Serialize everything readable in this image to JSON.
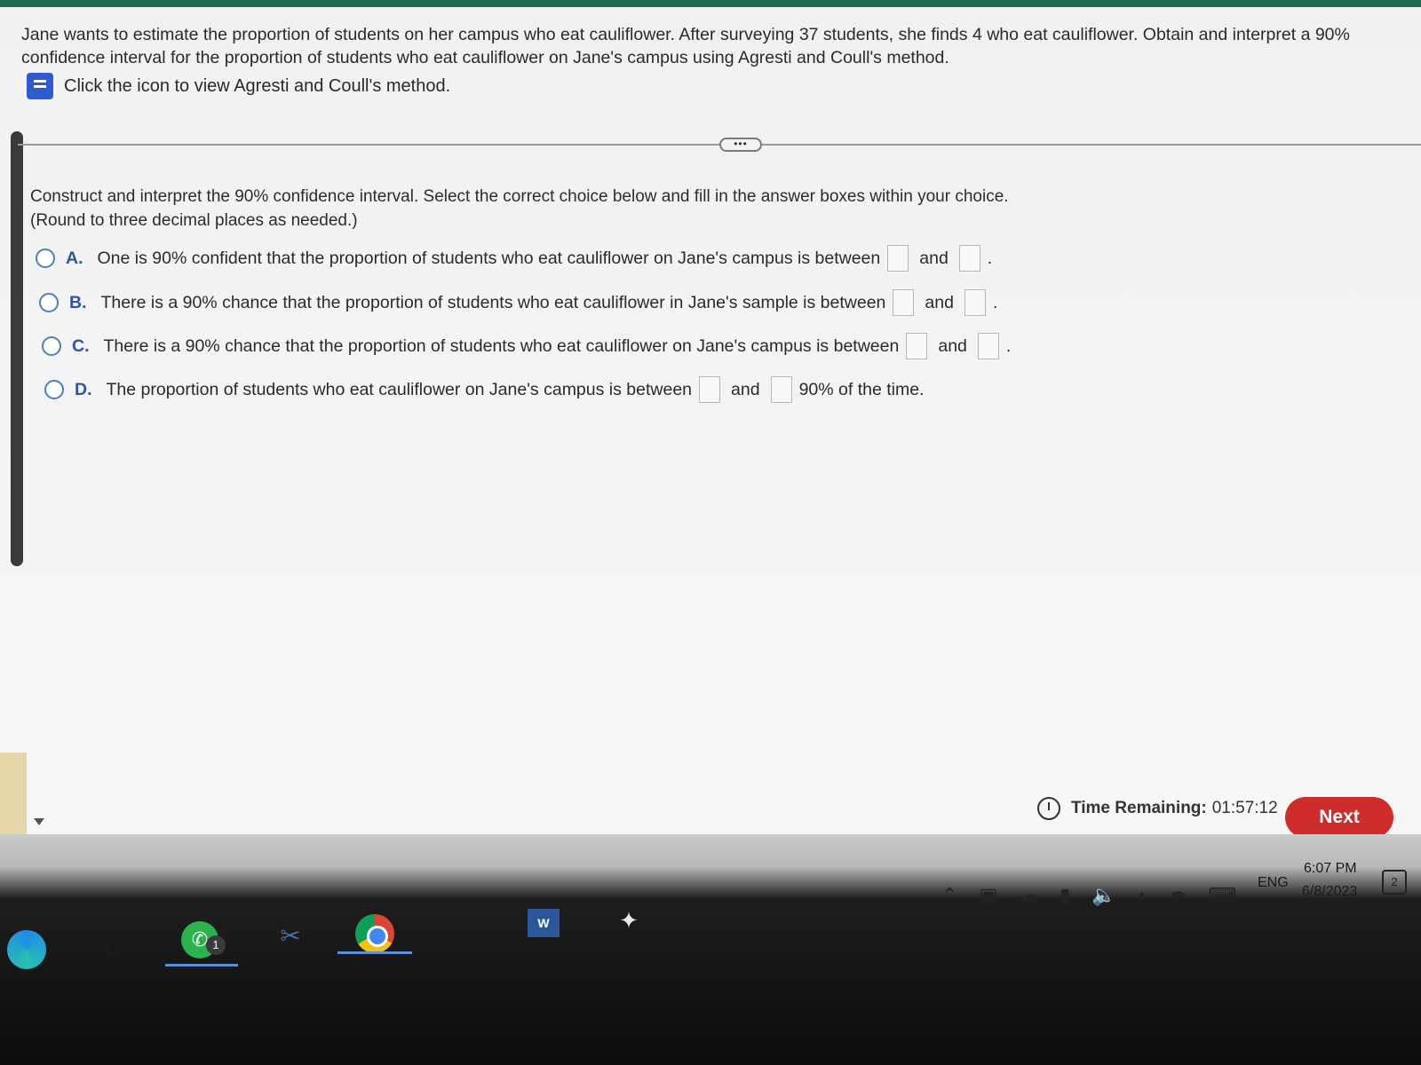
{
  "question": {
    "text": "Jane wants to estimate the proportion of students on her campus who eat cauliflower. After surveying 37 students, she finds 4 who eat cauliflower. Obtain and interpret a 90% confidence interval for the proportion of students who eat cauliflower on Jane's campus using Agresti and Coull's method.",
    "method_link": "Click the icon to view Agresti and Coull's method."
  },
  "more_button": "•••",
  "instructions": {
    "line1": "Construct and interpret the 90% confidence interval. Select the correct choice below and fill in the answer boxes within your choice.",
    "line2": "(Round to three decimal places as needed.)"
  },
  "choices": [
    {
      "letter": "A.",
      "text": "One is 90% confident that the proportion of students who eat cauliflower on Jane's campus is between",
      "and": "and",
      "suffix": "."
    },
    {
      "letter": "B.",
      "text": "There is a 90% chance that the proportion of students who eat cauliflower in Jane's sample is between",
      "and": "and",
      "suffix": "."
    },
    {
      "letter": "C.",
      "text": "There is a 90% chance that the proportion of students who eat cauliflower on Jane's campus is between",
      "and": "and",
      "suffix": "."
    },
    {
      "letter": "D.",
      "text": "The proportion of students who eat cauliflower on Jane's campus is between",
      "and": "and",
      "suffix": "90% of the time."
    }
  ],
  "footer": {
    "time_label": "Time Remaining:",
    "time_value": "01:57:12",
    "next_label": "Next"
  },
  "taskbar": {
    "whatsapp_badge": "1",
    "word_label": "W",
    "lang": "ENG",
    "time": "6:07 PM",
    "date": "6/8/2023",
    "notifications": "2"
  },
  "colors": {
    "accent": "#2a55a8",
    "next_button": "#cf2c2c",
    "top_bar": "#1f6b52"
  }
}
